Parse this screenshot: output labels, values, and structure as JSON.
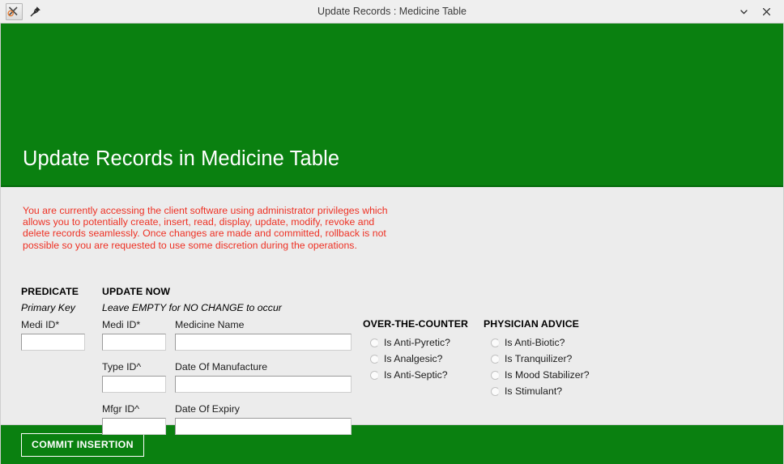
{
  "window": {
    "title": "Update Records : Medicine Table",
    "app_icon": "app-cancel-icon",
    "pin_icon": "pushpin-icon",
    "minimize_icon": "chevron-down-icon",
    "close_icon": "close-icon"
  },
  "banner": {
    "heading": "Update Records in Medicine Table",
    "color": "#0a8010"
  },
  "warning": {
    "text": "You are currently accessing the client software using administrator privileges which allows you to potentially create, insert, read, display, update, modify, revoke and delete records seamlessly. Once changes are made and committed, rollback is not possible so you are requested to use some discretion during the operations.",
    "color": "#ee3124"
  },
  "predicate": {
    "heading": "PREDICATE",
    "subheading": "Primary Key",
    "fields": [
      {
        "label": "Medi ID*",
        "value": "",
        "placeholder": ""
      }
    ]
  },
  "update": {
    "heading": "UPDATE NOW",
    "subheading": "Leave EMPTY for NO CHANGE to occur",
    "left_fields": [
      {
        "label": "Medi ID*",
        "value": "",
        "placeholder": ""
      },
      {
        "label": "Type ID^",
        "value": "",
        "placeholder": ""
      },
      {
        "label": "Mfgr ID^",
        "value": "",
        "placeholder": ""
      }
    ],
    "right_fields": [
      {
        "label": "Medicine Name",
        "value": "",
        "placeholder": ""
      },
      {
        "label": "Date Of Manufacture",
        "value": "",
        "placeholder": ""
      },
      {
        "label": "Date Of Expiry",
        "value": "",
        "placeholder": ""
      }
    ]
  },
  "over_the_counter": {
    "heading": "OVER-THE-COUNTER",
    "options": [
      {
        "label": "Is Anti-Pyretic?",
        "checked": false
      },
      {
        "label": "Is Analgesic?",
        "checked": false
      },
      {
        "label": "Is Anti-Septic?",
        "checked": false
      }
    ]
  },
  "physician_advice": {
    "heading": "PHYSICIAN ADVICE",
    "options": [
      {
        "label": "Is Anti-Biotic?",
        "checked": false
      },
      {
        "label": "Is Tranquilizer?",
        "checked": false
      },
      {
        "label": "Is Mood Stabilizer?",
        "checked": false
      },
      {
        "label": "Is Stimulant?",
        "checked": false
      }
    ]
  },
  "footer": {
    "commit_label": "COMMIT INSERTION"
  }
}
